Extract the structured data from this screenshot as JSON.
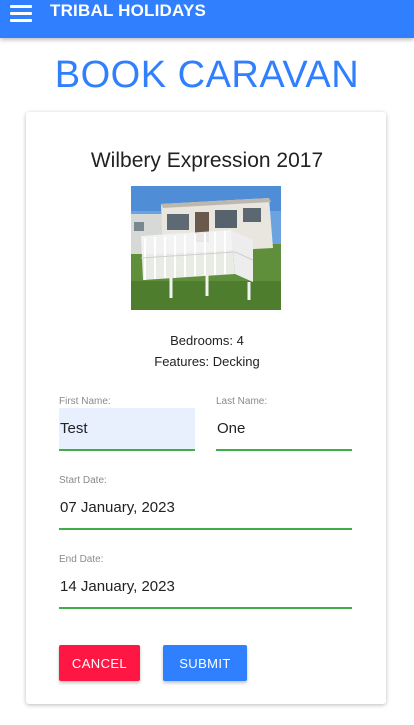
{
  "header": {
    "brand": "TRIBAL HOLIDAYS",
    "menu_icon": "hamburger-menu-icon",
    "color": "#2f7fff"
  },
  "page": {
    "title": "BOOK CARAVAN"
  },
  "caravan": {
    "name": "Wilbery Expression 2017",
    "bedrooms": "Bedrooms: 4",
    "features": "Features: Decking"
  },
  "form": {
    "first_name": {
      "label": "First Name:",
      "value": "Test"
    },
    "last_name": {
      "label": "Last Name:",
      "value": "One"
    },
    "start_date": {
      "label": "Start Date:",
      "value": "07 January, 2023"
    },
    "end_date": {
      "label": "End Date:",
      "value": "14 January, 2023"
    },
    "underline_color": "#3fae49"
  },
  "buttons": {
    "cancel": {
      "label": "CANCEL",
      "color": "#ff1744"
    },
    "submit": {
      "label": "SUBMIT",
      "color": "#2f7fff"
    }
  }
}
